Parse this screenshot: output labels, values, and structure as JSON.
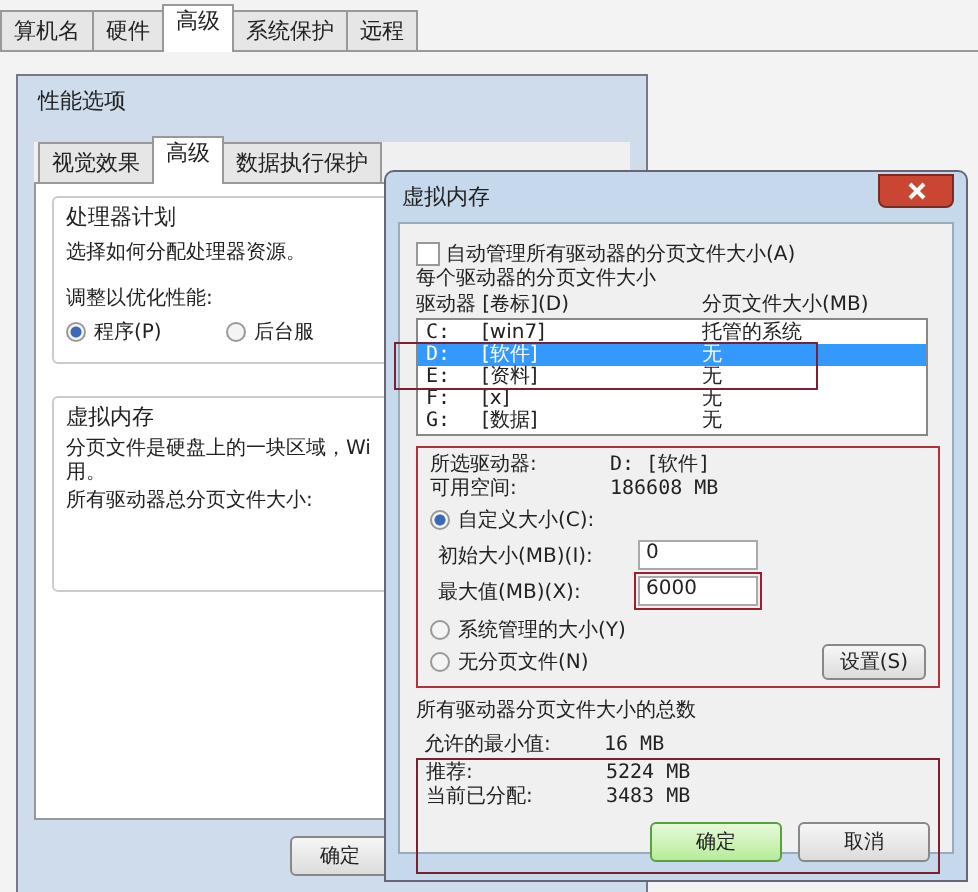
{
  "back_window": {
    "tabs": [
      {
        "label": "算机名",
        "selected": false
      },
      {
        "label": "硬件",
        "selected": false
      },
      {
        "label": "高级",
        "selected": true
      },
      {
        "label": "系统保护",
        "selected": false
      },
      {
        "label": "远程",
        "selected": false
      }
    ]
  },
  "performance_window": {
    "title": "性能选项",
    "tabs": [
      {
        "label": "视觉效果",
        "selected": false
      },
      {
        "label": "高级",
        "selected": true
      },
      {
        "label": "数据执行保护",
        "selected": false
      }
    ],
    "processor_group": {
      "title": "处理器计划",
      "description": "选择如何分配处理器资源。",
      "adjust_label": "调整以优化性能:",
      "options": [
        {
          "label": "程序(P)",
          "selected": true
        },
        {
          "label": "后台服",
          "selected": false
        }
      ]
    },
    "virtual_memory_group": {
      "title": "虚拟内存",
      "description": [
        "分页文件是硬盘上的一块区域，Wi",
        "用。"
      ],
      "total_label": "所有驱动器总分页文件大小:"
    },
    "buttons": [
      "确定"
    ]
  },
  "virtual_memory_dialog": {
    "title": "虚拟内存",
    "auto_manage": {
      "label": "自动管理所有驱动器的分页文件大小(A)",
      "checked": false
    },
    "section_label": "每个驱动器的分页文件大小",
    "columns": [
      "驱动器 [卷标](D)",
      "分页文件大小(MB)"
    ],
    "drives": [
      {
        "drive": "C:",
        "volume": "[win7]",
        "size": "托管的系统",
        "selected": false
      },
      {
        "drive": "D:",
        "volume": "[软件]",
        "size": "无",
        "selected": true
      },
      {
        "drive": "E:",
        "volume": "[资料]",
        "size": "无",
        "selected": false
      },
      {
        "drive": "F:",
        "volume": "[x]",
        "size": "无",
        "selected": false
      },
      {
        "drive": "G:",
        "volume": "[数据]",
        "size": "无",
        "selected": false
      }
    ],
    "info": [
      {
        "label": "所选驱动器:",
        "value": "D:  [软件]"
      },
      {
        "label": "可用空间:",
        "value": "186608 MB"
      }
    ],
    "size_options": [
      {
        "label": "自定义大小(C):",
        "selected": true
      },
      {
        "label": "系统管理的大小(Y)",
        "selected": false
      },
      {
        "label": "无分页文件(N)",
        "selected": false
      }
    ],
    "initial_size": {
      "label": "初始大小(MB)(I):",
      "value": "0"
    },
    "max_size": {
      "label": "最大值(MB)(X):",
      "value": "6000"
    },
    "set_button": "设置(S)",
    "totals": {
      "title": "所有驱动器分页文件大小的总数",
      "rows": [
        {
          "label": "允许的最小值:",
          "value": "16 MB"
        },
        {
          "label": "推荐:",
          "value": "5224 MB"
        },
        {
          "label": "当前已分配:",
          "value": "3483 MB"
        }
      ]
    },
    "buttons": [
      {
        "label": "确定",
        "kind": "default"
      },
      {
        "label": "取消",
        "kind": "normal"
      }
    ]
  }
}
